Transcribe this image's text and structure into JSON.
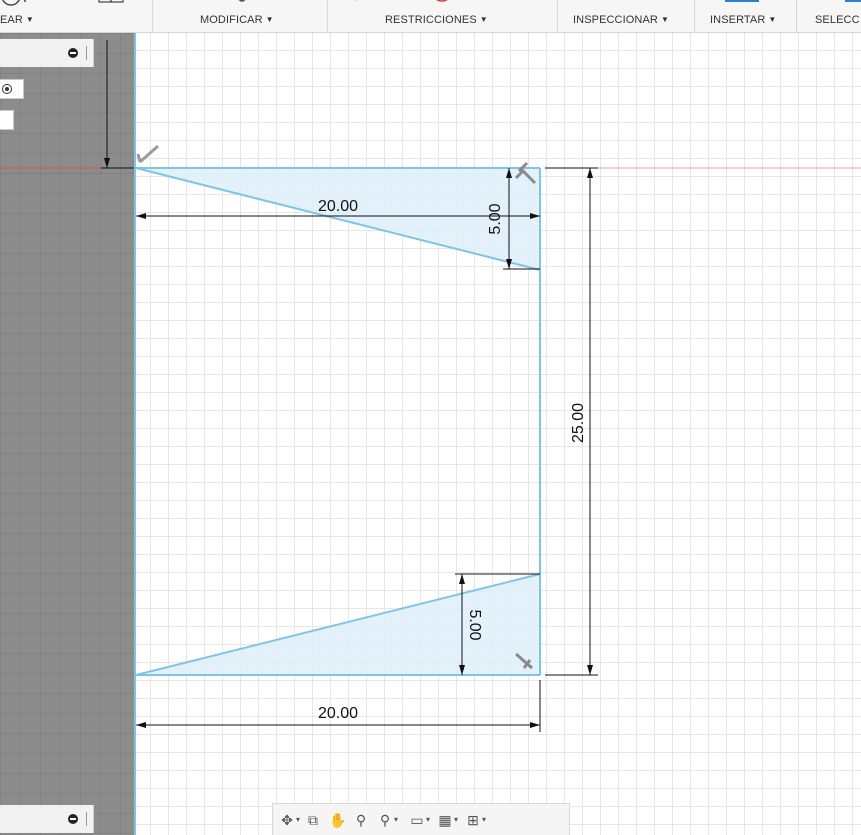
{
  "toolbar": {
    "crear": "EAR",
    "modificar": "MODIFICAR",
    "restricciones": "RESTRICCIONES",
    "inspeccionar": "INSPECCIONAR",
    "insertar": "INSERTAR",
    "seleccionar": "SELECC"
  },
  "sketch": {
    "dim_top_width": "20.00",
    "dim_top_height": "5.00",
    "dim_total_height": "25.00",
    "dim_bottom_height": "5.00",
    "dim_bottom_width": "20.00"
  },
  "colors": {
    "sketch_line": "#7ec4e8",
    "sketch_fill": "#ddeff9",
    "dimension": "#111111",
    "axis_red": "#e05050",
    "browser_bg": "#8c8c8c"
  },
  "navbar": {
    "icons": [
      "orbit-icon",
      "look-at-icon",
      "pan-icon",
      "zoom-icon",
      "fit-icon",
      "display-settings-icon",
      "grid-settings-icon",
      "viewports-icon"
    ]
  }
}
